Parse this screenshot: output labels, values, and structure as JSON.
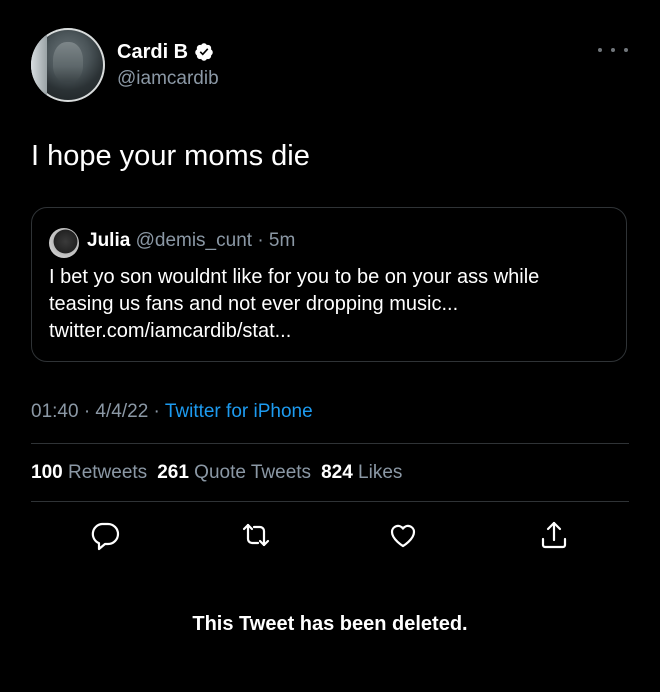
{
  "author": {
    "display_name": "Cardi B",
    "handle": "@iamcardib",
    "verified": true
  },
  "tweet": {
    "text": "I hope your moms die"
  },
  "quoted_tweet": {
    "display_name": "Julia",
    "meta": " @demis_cunt · 5m",
    "lines": [
      "I bet yo son wouldnt like for you to be on your ass while",
      "teasing us fans and not ever dropping music...",
      "twitter.com/iamcardib/stat..."
    ]
  },
  "timestamp": {
    "text": "01:40 · 4/4/22 · ",
    "source": "Twitter for iPhone"
  },
  "stats": {
    "retweets_count": "100",
    "retweets_label": "Retweets",
    "quotes_count": "261",
    "quotes_label": "Quote Tweets",
    "likes_count": "824",
    "likes_label": "Likes"
  },
  "actions": [
    "reply-icon",
    "retweet-icon",
    "like-icon",
    "share-icon"
  ],
  "notice": "This Tweet has been deleted.",
  "colors": {
    "background": "#000000",
    "secondary_text": "#8b98a5",
    "link": "#1d9bf0",
    "divider": "#2f3336"
  }
}
